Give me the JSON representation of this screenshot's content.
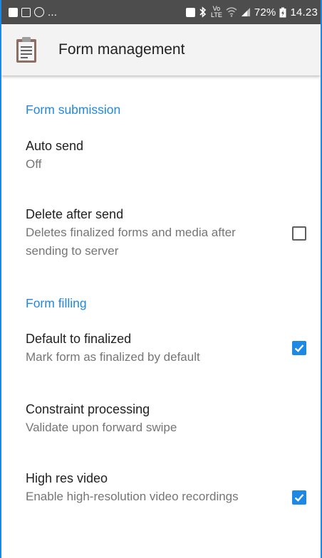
{
  "status_bar": {
    "left_text": "...",
    "battery": "72%",
    "time": "14.23",
    "network_label_top": "Vo",
    "network_label_bottom": "LTE"
  },
  "app_bar": {
    "title": "Form management",
    "icon": "clipboard-icon"
  },
  "sections": {
    "submission": {
      "header": "Form submission",
      "auto_send": {
        "title": "Auto send",
        "summary": "Off"
      },
      "delete_after_send": {
        "title": "Delete after send",
        "summary": "Deletes finalized forms and media after sending to server",
        "checked": false
      }
    },
    "filling": {
      "header": "Form filling",
      "default_finalized": {
        "title": "Default to finalized",
        "summary": "Mark form as finalized by default",
        "checked": true
      },
      "constraint_processing": {
        "title": "Constraint processing",
        "summary": "Validate upon forward swipe"
      },
      "high_res_video": {
        "title": "High res video",
        "summary": "Enable high-resolution video recordings",
        "checked": true
      }
    }
  },
  "colors": {
    "accent": "#1e88e5",
    "status_bar": "#4d4d4d",
    "app_bar": "#f3f3f3"
  }
}
